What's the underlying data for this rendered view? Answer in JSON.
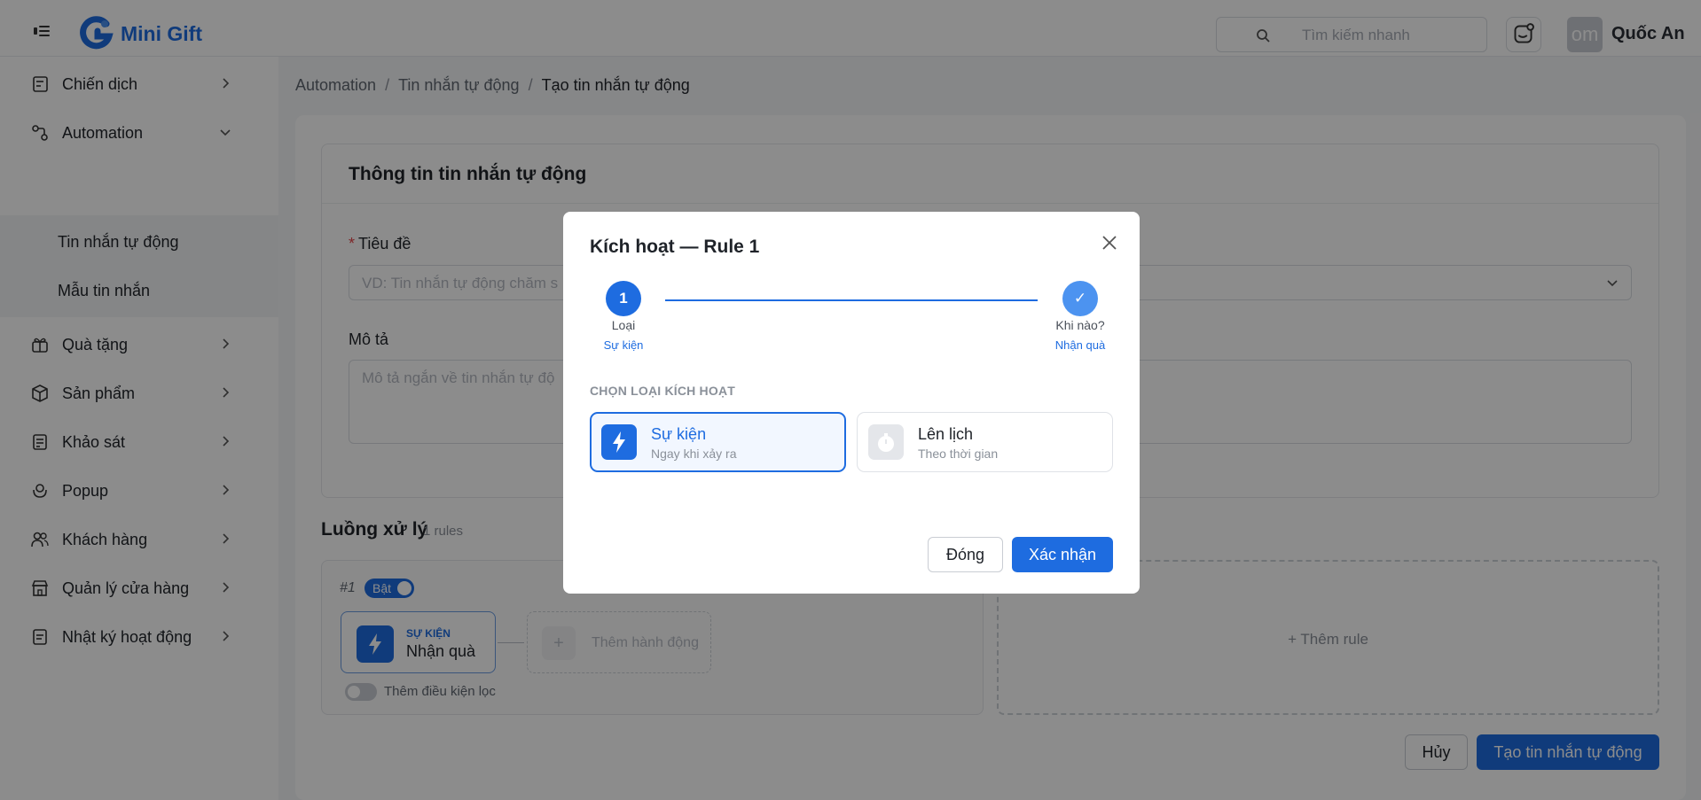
{
  "header": {
    "brand": "Mini Gift",
    "search_placeholder": "Tìm kiếm nhanh",
    "avatar_initials": "om",
    "username": "Quốc An"
  },
  "sidebar": {
    "items": [
      {
        "label": "Chiến dịch",
        "icon": "campaign-icon"
      },
      {
        "label": "Automation",
        "icon": "automation-icon"
      },
      {
        "label": "Quà tặng",
        "icon": "gift-icon"
      },
      {
        "label": "Sản phẩm",
        "icon": "box-icon"
      },
      {
        "label": "Khảo sát",
        "icon": "survey-icon"
      },
      {
        "label": "Popup",
        "icon": "popup-icon"
      },
      {
        "label": "Khách hàng",
        "icon": "users-icon"
      },
      {
        "label": "Quản lý cửa hàng",
        "icon": "store-icon"
      },
      {
        "label": "Nhật ký hoạt động",
        "icon": "log-icon"
      }
    ],
    "automation_sub": [
      "Tin nhắn tự động",
      "Mẫu tin nhắn"
    ]
  },
  "breadcrumb": [
    "Automation",
    "Tin nhắn tự động",
    "Tạo tin nhắn tự động"
  ],
  "form": {
    "section_title": "Thông tin tin nhắn tự động",
    "title_label": "Tiêu đề",
    "title_placeholder": "VD: Tin nhắn tự động chăm s",
    "desc_label": "Mô tả",
    "desc_placeholder": "Mô tả ngắn về tin nhắn tự độ"
  },
  "flow": {
    "title": "Luồng xử lý",
    "count": "1 rules",
    "rule_number": "#1",
    "rule_toggle": "Bật",
    "event_kind": "SỰ KIỆN",
    "event_value": "Nhận quà",
    "add_action": "Thêm hành động",
    "filter_label": "Thêm điều kiện lọc",
    "add_rule": "+ Thêm rule"
  },
  "footer": {
    "cancel": "Hủy",
    "create": "Tạo tin nhắn tự động"
  },
  "modal": {
    "title": "Kích hoạt — Rule 1",
    "step1_number": "1",
    "step1_label": "Loại",
    "step1_sub": "Sự kiện",
    "step2_check": "✓",
    "step2_label": "Khi nào?",
    "step2_sub": "Nhận quà",
    "choose_label": "CHỌN LOẠI KÍCH HOẠT",
    "option_event_title": "Sự kiện",
    "option_event_sub": "Ngay khi xảy ra",
    "option_schedule_title": "Lên lịch",
    "option_schedule_sub": "Theo thời gian",
    "close_btn": "Đóng",
    "confirm_btn": "Xác nhận"
  },
  "colors": {
    "primary": "#1e6ce0",
    "overlay": "rgba(0,0,0,0.45)"
  }
}
